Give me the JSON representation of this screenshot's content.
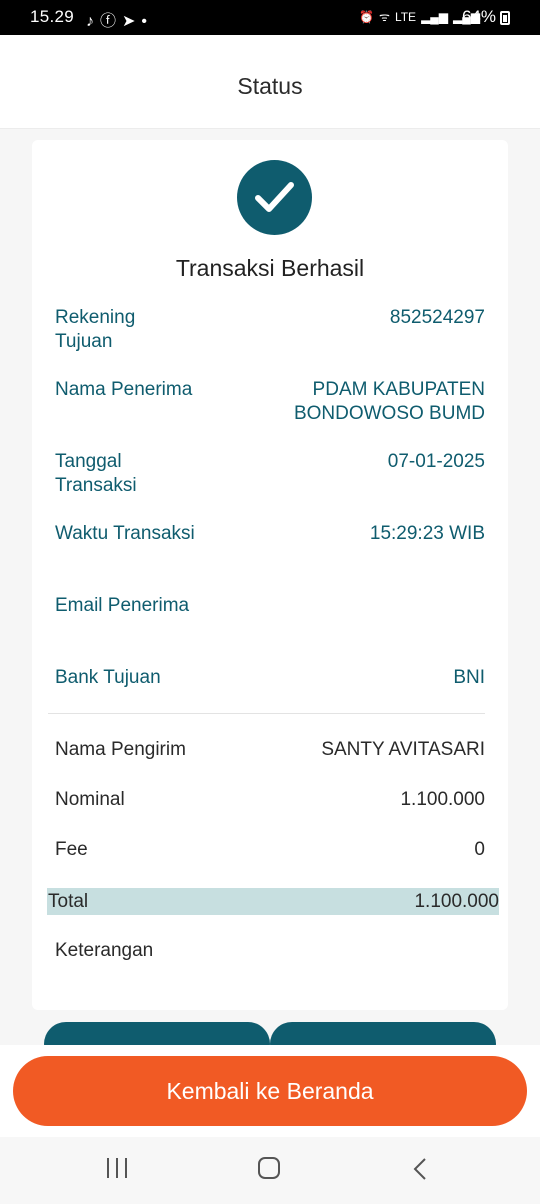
{
  "status_bar": {
    "time": "15.29",
    "left_icons": [
      "tiktok-icon",
      "facebook-icon",
      "telegram-icon",
      "dot-icon"
    ],
    "right_icons": [
      "alarm-icon",
      "wifi-icon",
      "volte-icon",
      "signal-icon",
      "signal-icon"
    ],
    "battery": "64%"
  },
  "header": {
    "title": "Status"
  },
  "card": {
    "title": "Transaksi Berhasil",
    "details": [
      {
        "label": "Rekening Tujuan",
        "value": "852524297"
      },
      {
        "label": "Nama Penerima",
        "value": "PDAM KABUPATEN BONDOWOSO BUMD"
      },
      {
        "label": "Tanggal Transaksi",
        "value": "07-01-2025"
      },
      {
        "label": "Waktu Transaksi",
        "value": "15:29:23 WIB"
      },
      {
        "label": "Email Penerima",
        "value": ""
      },
      {
        "label": "Bank Tujuan",
        "value": "BNI"
      }
    ],
    "summary": [
      {
        "label": "Nama Pengirim",
        "value": "SANTY AVITASARI"
      },
      {
        "label": "Nominal",
        "value": "1.100.000"
      },
      {
        "label": "Fee",
        "value": "0"
      }
    ],
    "total": {
      "label": "Total",
      "value": "1.100.000"
    },
    "note": {
      "label": "Keterangan",
      "value": ""
    }
  },
  "actions": {
    "back_home": "Kembali ke Beranda"
  },
  "colors": {
    "primary": "#0f5c6e",
    "accent": "#f15a24",
    "total_highlight": "#c7dfe0"
  }
}
